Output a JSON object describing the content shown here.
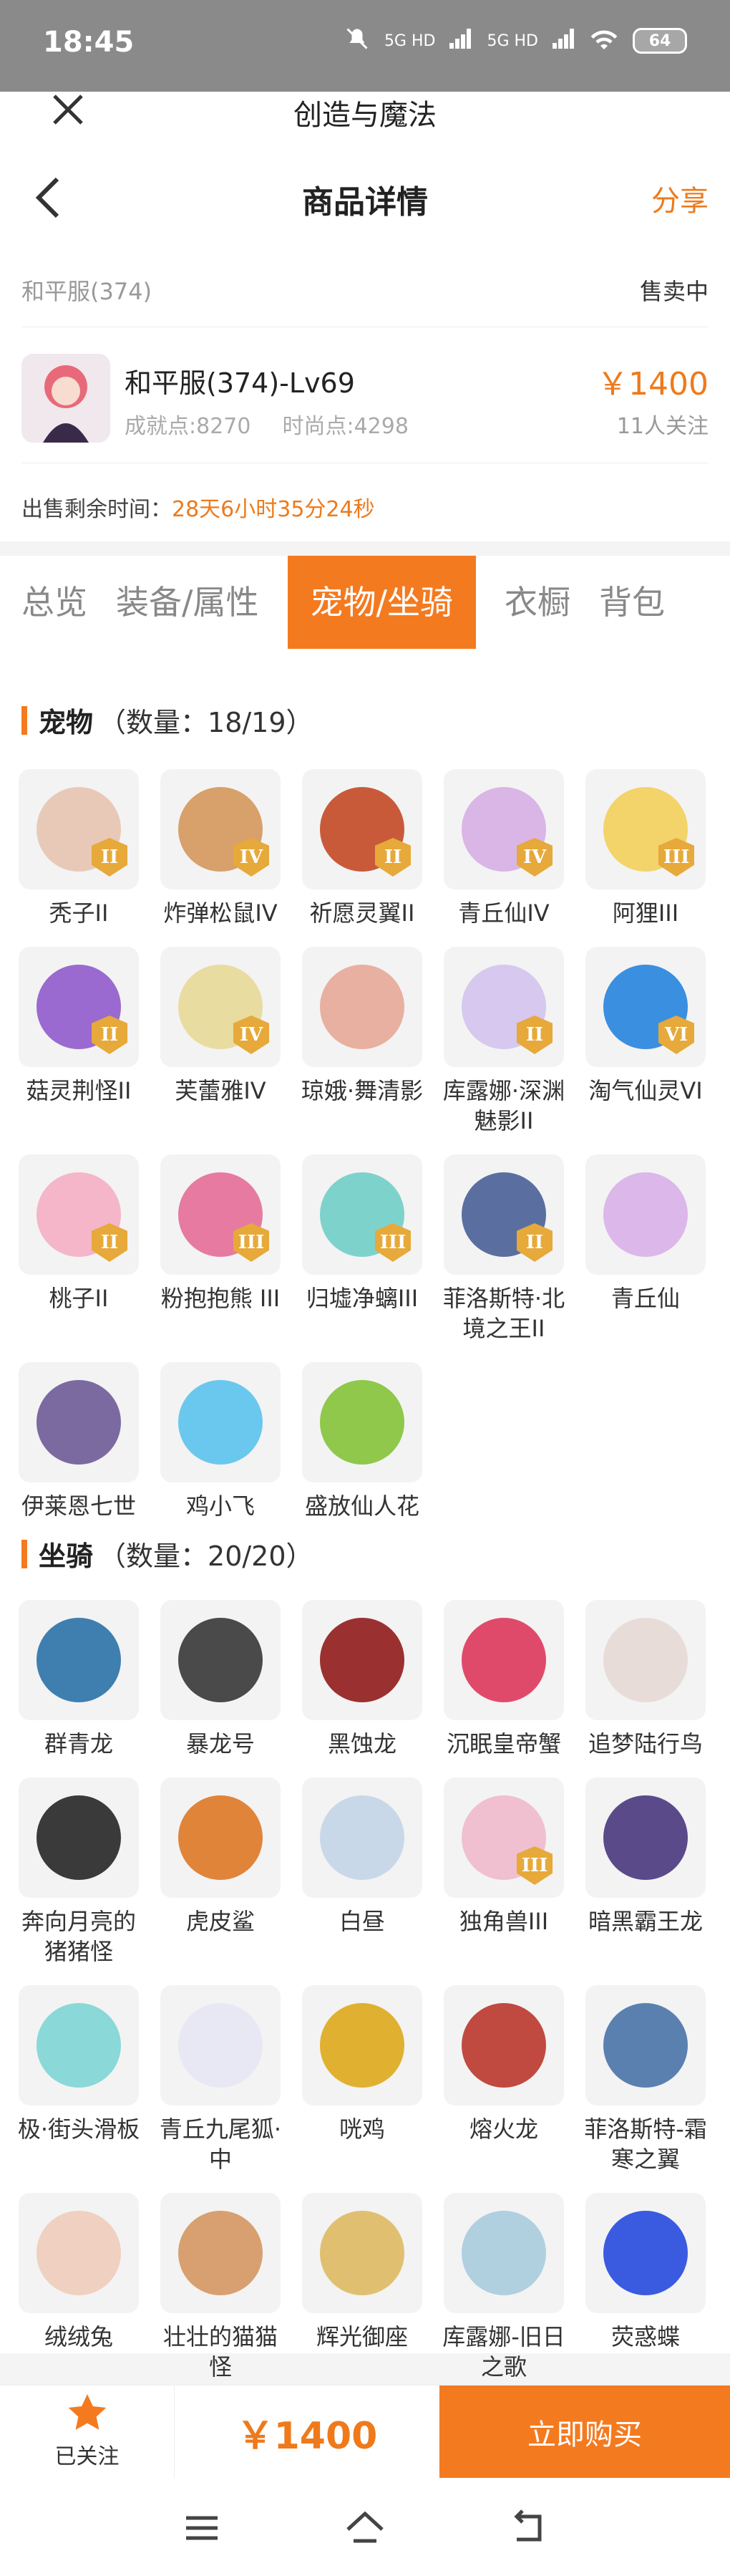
{
  "status_bar": {
    "time": "18:45",
    "signal1": "5G HD",
    "signal2": "5G HD",
    "battery": "64"
  },
  "app": {
    "title": "创造与魔法"
  },
  "header": {
    "title": "商品详情",
    "share": "分享"
  },
  "item": {
    "server": "和平服(374)",
    "status": "售卖中",
    "character": "和平服(374)-Lv69",
    "achievement": "成就点:8270",
    "fashion": "时尚点:4298",
    "price": "￥1400",
    "followers": "11人关注",
    "remaining_label": "出售剩余时间：",
    "remaining_value": "28天6小时35分24秒"
  },
  "tabs": [
    "总览",
    "装备/属性",
    "宠物/坐骑",
    "衣橱",
    "背包"
  ],
  "active_tab": "宠物/坐骑",
  "pets": {
    "title": "宠物",
    "count": "（数量：18/19）",
    "items": [
      {
        "name": "秃子II",
        "rank": "II",
        "color": "#e8c9b8"
      },
      {
        "name": "炸弹松鼠IV",
        "rank": "IV",
        "color": "#d8a06a"
      },
      {
        "name": "祈愿灵翼II",
        "rank": "II",
        "color": "#c85a3a"
      },
      {
        "name": "青丘仙IV",
        "rank": "IV",
        "color": "#d9b6e6"
      },
      {
        "name": "阿狸III",
        "rank": "III",
        "color": "#f3d46a"
      },
      {
        "name": "菇灵荆怪II",
        "rank": "II",
        "color": "#9a6ad0"
      },
      {
        "name": "芙蕾雅IV",
        "rank": "IV",
        "color": "#e9dca0"
      },
      {
        "name": "琼娥·舞清影",
        "rank": "",
        "color": "#e8b0a0"
      },
      {
        "name": "库露娜·深渊魅影II",
        "rank": "II",
        "color": "#d6c8ee"
      },
      {
        "name": "淘气仙灵VI",
        "rank": "VI",
        "color": "#3a8fe0"
      },
      {
        "name": "桃子II",
        "rank": "II",
        "color": "#f4b6c8"
      },
      {
        "name": "粉抱抱熊 III",
        "rank": "III",
        "color": "#e67aa0"
      },
      {
        "name": "归墟净螭III",
        "rank": "III",
        "color": "#7ed2cc"
      },
      {
        "name": "菲洛斯特·北境之王II",
        "rank": "II",
        "color": "#5a6fa0"
      },
      {
        "name": "青丘仙",
        "rank": "",
        "color": "#dcb7ea"
      },
      {
        "name": "伊莱恩七世",
        "rank": "",
        "color": "#7b6aa0"
      },
      {
        "name": "鸡小飞",
        "rank": "",
        "color": "#6ac8ee"
      },
      {
        "name": "盛放仙人花",
        "rank": "",
        "color": "#8fc84a"
      }
    ]
  },
  "mounts": {
    "title": "坐骑",
    "count": "（数量：20/20）",
    "items": [
      {
        "name": "群青龙",
        "rank": "",
        "color": "#3e7fb0"
      },
      {
        "name": "暴龙号",
        "rank": "",
        "color": "#4a4a4a"
      },
      {
        "name": "黑蚀龙",
        "rank": "",
        "color": "#9a3030"
      },
      {
        "name": "沉眠皇帝蟹",
        "rank": "",
        "color": "#e04a6a"
      },
      {
        "name": "追梦陆行鸟",
        "rank": "",
        "color": "#e8dcd8"
      },
      {
        "name": "奔向月亮的猪猪怪",
        "rank": "",
        "color": "#3a3a3a"
      },
      {
        "name": "虎皮鲨",
        "rank": "",
        "color": "#e0843a"
      },
      {
        "name": "白昼",
        "rank": "",
        "color": "#c8d8e8"
      },
      {
        "name": "独角兽III",
        "rank": "III",
        "color": "#f0c0d0"
      },
      {
        "name": "暗黑霸王龙",
        "rank": "",
        "color": "#5a4a8a"
      },
      {
        "name": "极·街头滑板",
        "rank": "",
        "color": "#8ad8d8"
      },
      {
        "name": "青丘九尾狐·中",
        "rank": "",
        "color": "#e8e8f4"
      },
      {
        "name": "咣鸡",
        "rank": "",
        "color": "#e0b030"
      },
      {
        "name": "熔火龙",
        "rank": "",
        "color": "#c04a40"
      },
      {
        "name": "菲洛斯特-霜寒之翼",
        "rank": "",
        "color": "#5a80b0"
      },
      {
        "name": "绒绒兔",
        "rank": "",
        "color": "#f0d0c0"
      },
      {
        "name": "壮壮的猫猫怪",
        "rank": "",
        "color": "#d8a070"
      },
      {
        "name": "辉光御座",
        "rank": "",
        "color": "#e0c070"
      },
      {
        "name": "库露娜-旧日之歌",
        "rank": "",
        "color": "#b0d0e0"
      },
      {
        "name": "荧惑蝶",
        "rank": "",
        "color": "#3a5ae0"
      }
    ]
  },
  "bottom": {
    "follow_label": "已关注",
    "price": "￥1400",
    "buy": "立即购买"
  },
  "colors": {
    "accent": "#f47a20",
    "price": "#ee7a1b"
  }
}
